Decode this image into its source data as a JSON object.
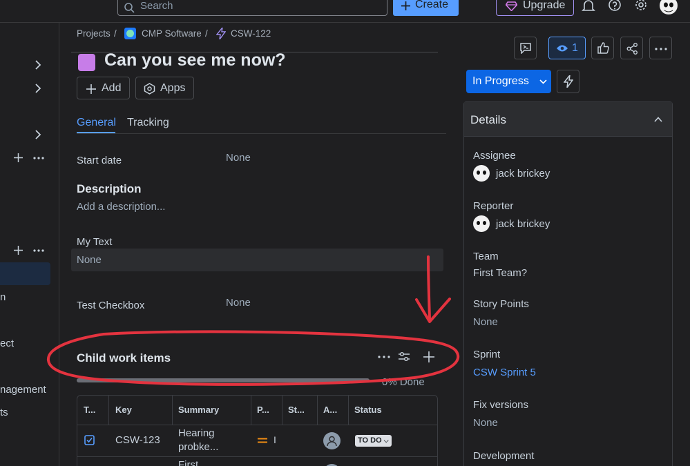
{
  "topbar": {
    "search_placeholder": "Search",
    "create_label": "Create",
    "upgrade_label": "Upgrade"
  },
  "sidebar": {
    "items": [
      "n",
      "ect",
      "nagement",
      "ts"
    ]
  },
  "breadcrumb": {
    "projects": "Projects",
    "separator": "/",
    "project": "CMP Software",
    "issue_key": "CSW-122"
  },
  "issue": {
    "title": "Can you see me now?",
    "add_label": "Add",
    "apps_label": "Apps"
  },
  "tabs": [
    "General",
    "Tracking"
  ],
  "fields": {
    "start_date_label": "Start date",
    "start_date_value": "None",
    "description_label": "Description",
    "description_placeholder": "Add a description...",
    "my_text_label": "My Text",
    "my_text_value": "None",
    "test_checkbox_label": "Test Checkbox",
    "test_checkbox_value": "None"
  },
  "child_items": {
    "heading": "Child work items",
    "progress_text": "0% Done",
    "progress_fraction": 0.0,
    "columns": [
      "T...",
      "Key",
      "Summary",
      "P...",
      "St...",
      "A...",
      "Status"
    ],
    "rows": [
      {
        "key": "CSW-123",
        "summary_line1": "Hearing",
        "summary_line2": "probke...",
        "priority": "I",
        "status": "TO DO"
      },
      {
        "summary_line1": "First"
      }
    ]
  },
  "actions": {
    "watchers_count": "1",
    "status_label": "In Progress"
  },
  "details": {
    "heading": "Details",
    "assignee_label": "Assignee",
    "assignee_value": "jack brickey",
    "reporter_label": "Reporter",
    "reporter_value": "jack brickey",
    "team_label": "Team",
    "team_value": "First Team?",
    "story_points_label": "Story Points",
    "story_points_value": "None",
    "sprint_label": "Sprint",
    "sprint_value": "CSW Sprint 5",
    "fix_versions_label": "Fix versions",
    "fix_versions_value": "None",
    "development_label": "Development"
  },
  "colors": {
    "background": "#1f1f21",
    "accent": "#579dff",
    "primary_button": "#0c66e4",
    "annotation_red": "#e3333f",
    "issue_icon": "#c77de8"
  }
}
